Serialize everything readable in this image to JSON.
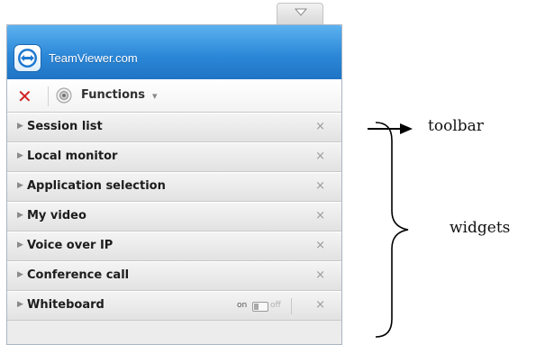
{
  "app": {
    "brand": "TeamViewer.com",
    "brand_color": "#2d88d8"
  },
  "toolbar": {
    "close_icon": "close-icon",
    "functions_label": "Functions",
    "functions_icon": "functions-icon",
    "caret": "▾"
  },
  "widgets": [
    {
      "label": "Session list"
    },
    {
      "label": "Local monitor"
    },
    {
      "label": "Application selection"
    },
    {
      "label": "My video"
    },
    {
      "label": "Voice over IP"
    },
    {
      "label": "Conference call"
    },
    {
      "label": "Whiteboard",
      "toggle": {
        "on": "on",
        "off": "off"
      }
    }
  ],
  "row_close": "×",
  "annotations": {
    "toolbar": "toolbar",
    "widgets": "widgets"
  }
}
